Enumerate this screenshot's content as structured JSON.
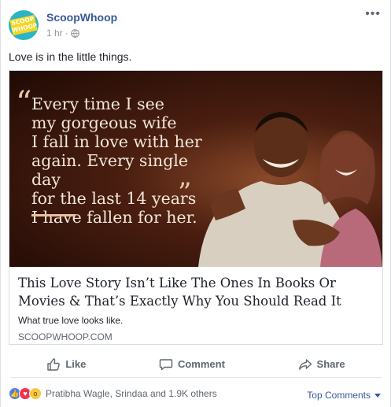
{
  "post": {
    "page_name": "ScoopWhoop",
    "avatar_text": "SCOOP WHOOP",
    "time": "1 hr",
    "separator": "·",
    "text": "Love is in the little things."
  },
  "link": {
    "image_quote": "Every time I see\nmy gorgeous wife\nI fall in love with her\nagain. Every single day\nfor the last 14 years\nI have fallen for her.",
    "quote_open": "“",
    "quote_close": "”",
    "title": "This Love Story Isn’t Like The Ones In Books Or Movies & That’s Exactly Why You Should Read It",
    "description": "What true love looks like.",
    "domain": "SCOOPWHOOP.COM"
  },
  "actions": {
    "like": "Like",
    "comment": "Comment",
    "share": "Share"
  },
  "reactions": {
    "names": "Pratibha Wagle, Srindaa and 1.9K others",
    "top_comments": "Top Comments",
    "types": [
      "like-icon",
      "love-icon",
      "wow-icon"
    ]
  },
  "colors": {
    "link_blue": "#365899",
    "secondary_text": "#606770",
    "like_blue": "#4c7fe8",
    "love_red": "#f0334f",
    "wow_yellow": "#f7c843",
    "avatar_teal": "#2bb4c5",
    "avatar_yellow": "#f3d624"
  }
}
